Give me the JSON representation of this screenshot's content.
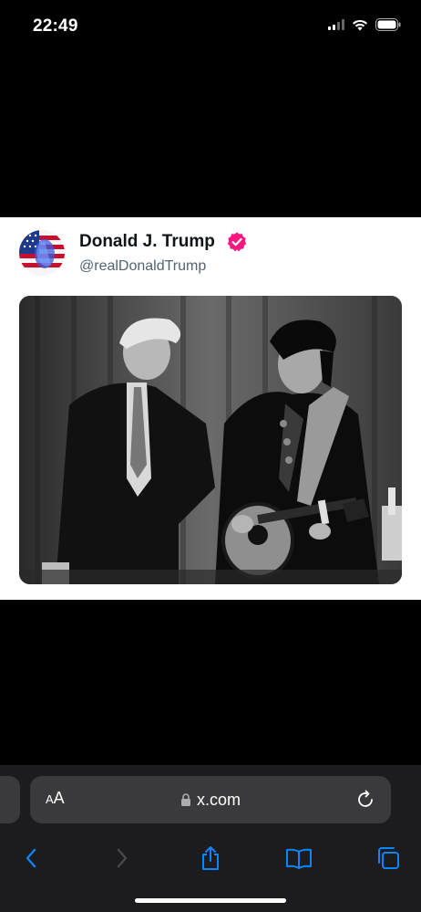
{
  "status_bar": {
    "time": "22:49"
  },
  "tweet": {
    "author_name": "Donald J. Trump",
    "handle": "@realDonaldTrump",
    "verified_color": "#f91880"
  },
  "browser": {
    "text_size_small": "A",
    "text_size_large": "A",
    "url": "x.com",
    "accent": "#0a84ff"
  },
  "icons": {
    "signal": "cellular-signal-icon",
    "wifi": "wifi-icon",
    "battery": "battery-icon",
    "lock": "lock-icon",
    "reload": "reload-icon",
    "back": "chevron-left-icon",
    "forward": "chevron-right-icon",
    "share": "share-icon",
    "bookmarks": "book-icon",
    "tabs": "tabs-icon"
  }
}
